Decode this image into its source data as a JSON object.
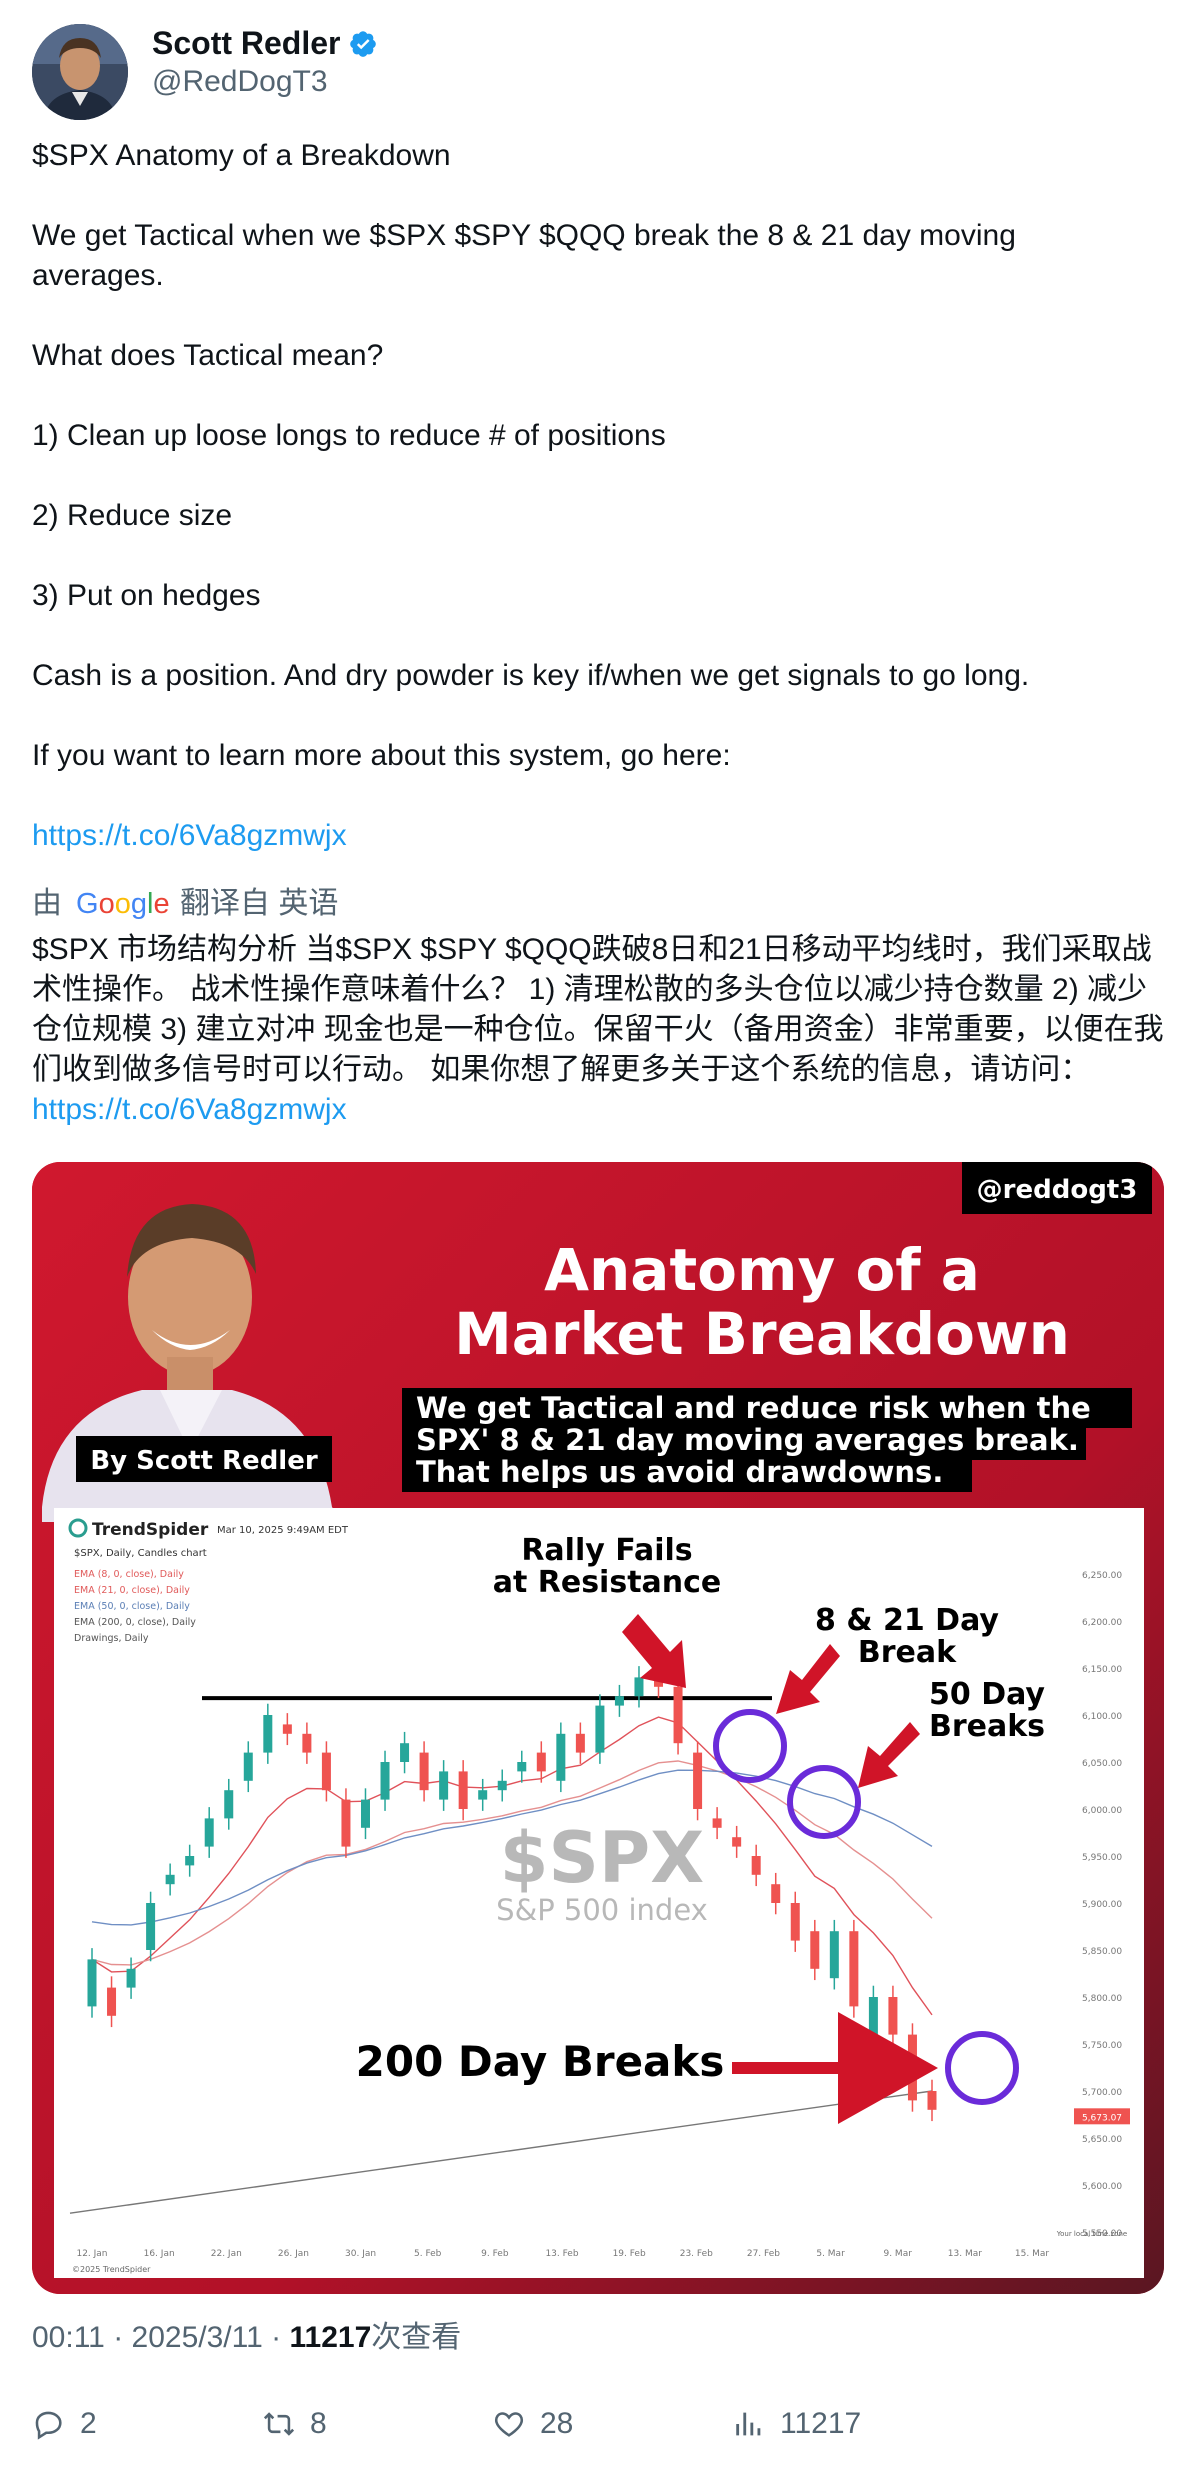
{
  "author": {
    "name": "Scott Redler",
    "handle": "@RedDogT3"
  },
  "tweet": {
    "paragraphs": [
      "$SPX Anatomy of a Breakdown",
      "We get Tactical when we $SPX $SPY $QQQ break the 8 & 21 day moving averages.",
      "What does Tactical mean?",
      "1) Clean up loose longs to reduce # of positions",
      "2) Reduce size",
      "3) Put on hedges",
      "Cash is a position. And dry powder is key if/when we get signals to go long.",
      "If you want to learn more about this system, go here:"
    ],
    "link": "https://t.co/6Va8gzmwjx"
  },
  "translation": {
    "prefix": "由",
    "provider": "Google",
    "suffix": "翻译自 英语",
    "text": "$SPX 市场结构分析 当$SPX $SPY $QQQ跌破8日和21日移动平均线时，我们采取战术性操作。 战术性操作意味着什么？ 1) 清理松散的多头仓位以减少持仓数量 2) 减少仓位规模 3) 建立对冲 现金也是一种仓位。保留干火（备用资金）非常重要，以便在我们收到做多信号时可以行动。 如果你想了解更多关于这个系统的信息，请访问：",
    "link": "https://t.co/6Va8gzmwjx"
  },
  "media": {
    "tag": "@reddogt3",
    "title_line1": "Anatomy of a",
    "title_line2": "Market Breakdown",
    "subtitle_line1": "We get Tactical and reduce risk when the",
    "subtitle_line2": "SPX' 8 & 21 day moving averages break.",
    "subtitle_line3": "That helps us avoid drawdowns.",
    "byline": "By Scott Redler",
    "chart_brand": "TrendSpider",
    "chart_date": "Mar 10, 2025 9:49AM EDT",
    "chart_symbol_line": "$SPX, Daily, Candles chart",
    "indicators": [
      "EMA (8, 0, close), Daily",
      "EMA (21, 0, close), Daily",
      "EMA (50, 0, close), Daily",
      "EMA (200, 0, close), Daily",
      "Drawings, Daily"
    ],
    "watermark_symbol": "$SPX",
    "watermark_name": "S&P 500 index",
    "annotation_rally_1": "Rally Fails",
    "annotation_rally_2": "at Resistance",
    "annotation_break_1": "8 & 21 Day",
    "annotation_break_2": "Break",
    "annotation_50_1": "50 Day",
    "annotation_50_2": "Breaks",
    "annotation_200": "200 Day Breaks",
    "y_ticks": [
      "6,250.00",
      "6,200.00",
      "6,150.00",
      "6,100.00",
      "6,050.00",
      "6,000.00",
      "5,950.00",
      "5,900.00",
      "5,850.00",
      "5,800.00",
      "5,750.00",
      "5,700.00",
      "5,650.00",
      "5,600.00",
      "5,550.00"
    ],
    "x_ticks": [
      "12. Jan",
      "16. Jan",
      "22. Jan",
      "26. Jan",
      "30. Jan",
      "5. Feb",
      "9. Feb",
      "13. Feb",
      "19. Feb",
      "23. Feb",
      "27. Feb",
      "5. Mar",
      "9. Mar",
      "13. Mar",
      "15. Mar"
    ],
    "price_tag": "5,673.07",
    "timezone_note": "Your local time zone",
    "copyright": "©2025 TrendSpider",
    "colors": {
      "up": "#26a69a",
      "down": "#ef5350",
      "brand_red": "#c8152a",
      "circle": "#6a2bd9"
    }
  },
  "meta": {
    "time": "00:11",
    "date": "2025/3/11",
    "views": "11217",
    "views_suffix": "次查看",
    "sep": "·"
  },
  "actions": {
    "replies": "2",
    "retweets": "8",
    "likes": "28",
    "views": "11217"
  },
  "chart_data": {
    "type": "table",
    "y_axis_ticks": [
      6250,
      6200,
      6150,
      6100,
      6050,
      6000,
      5950,
      5900,
      5850,
      5800,
      5750,
      5700,
      5650,
      5600,
      5550
    ],
    "last_price": 5673.07,
    "resistance_level": 6118,
    "series": [
      {
        "name": "EMA (8, 0, close), Daily"
      },
      {
        "name": "EMA (21, 0, close), Daily"
      },
      {
        "name": "EMA (50, 0, close), Daily"
      },
      {
        "name": "EMA (200, 0, close), Daily"
      }
    ],
    "candles_close": [
      5840,
      5780,
      5830,
      5900,
      5930,
      5950,
      5990,
      6020,
      6060,
      6100,
      6080,
      6060,
      6020,
      5960,
      6010,
      6050,
      6070,
      6020,
      6040,
      6000,
      6020,
      6030,
      6050,
      6040,
      6080,
      6060,
      6110,
      6120,
      6140,
      6130,
      6070,
      6000,
      5980,
      5960,
      5930,
      5900,
      5860,
      5830,
      5870,
      5790,
      5800,
      5760,
      5690,
      5680
    ],
    "candles_open": [
      5790,
      5810,
      5810,
      5850,
      5920,
      5940,
      5960,
      5990,
      6030,
      6060,
      6090,
      6080,
      6060,
      6010,
      5980,
      6010,
      6050,
      6060,
      6010,
      6040,
      6010,
      6020,
      6040,
      6060,
      6030,
      6080,
      6060,
      6110,
      6120,
      6150,
      6130,
      6060,
      5990,
      5970,
      5950,
      5920,
      5900,
      5870,
      5820,
      5870,
      5760,
      5800,
      5760,
      5700
    ]
  }
}
